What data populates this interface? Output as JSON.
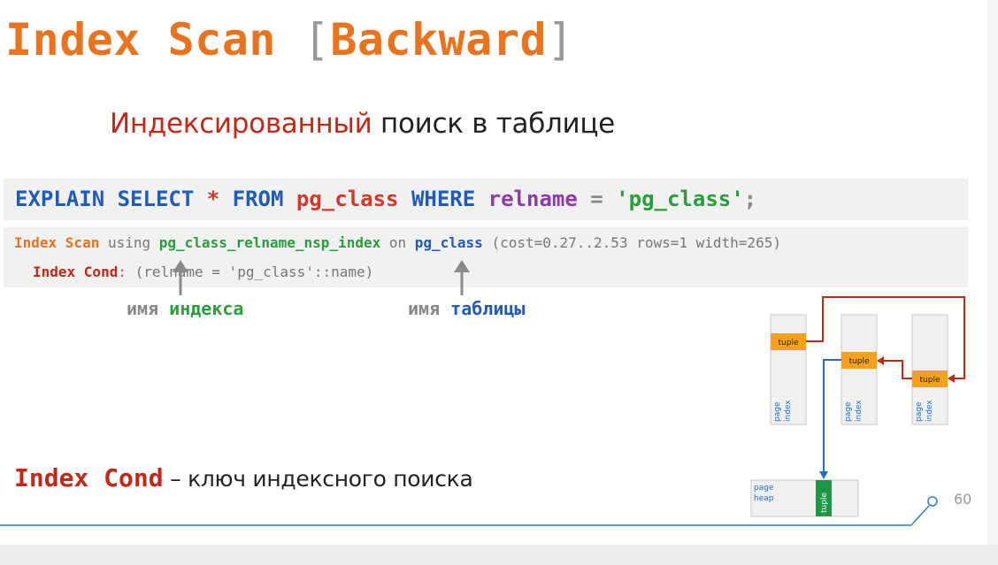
{
  "slide": {
    "title_main": "Index Scan ",
    "title_open": "[",
    "title_inner": "Backward",
    "title_close": "]",
    "subtitle_red": "Индексированный",
    "subtitle_rest": " поиск в таблице",
    "page_number": "60"
  },
  "query": {
    "explain": "EXPLAIN SELECT ",
    "star": "*",
    "from": " FROM ",
    "table": "pg_class",
    "where": " WHERE ",
    "column": "relname",
    "eq": " = ",
    "value": "'pg_class'",
    "semi": ";"
  },
  "plan": {
    "node": "Index Scan",
    "using": " using ",
    "index_name": "pg_class_relname_nsp_index",
    "on": " on ",
    "table": "pg_class",
    "cost": "  (cost=0.27..2.53 rows=1 width=265)",
    "cond_label": "Index Cond",
    "cond_text": ": (relname = 'pg_class'::name)"
  },
  "labels": {
    "index_prefix": "имя ",
    "index_word": "индекса",
    "table_prefix": "имя ",
    "table_word": "таблицы"
  },
  "bottom": {
    "term": "Index Cond",
    "desc": " – ключ индексного поиска"
  },
  "diagram": {
    "tuple_label": "tuple",
    "index_page_label": "page index",
    "heap_page_line1": "page",
    "heap_page_line2": "heap",
    "index_page_line1": "page",
    "index_page_line2": "index",
    "colors": {
      "orange": "#f5a11d",
      "green": "#1e9646",
      "red_arrow": "#c0281a",
      "blue_arrow": "#1f6fc0"
    }
  }
}
